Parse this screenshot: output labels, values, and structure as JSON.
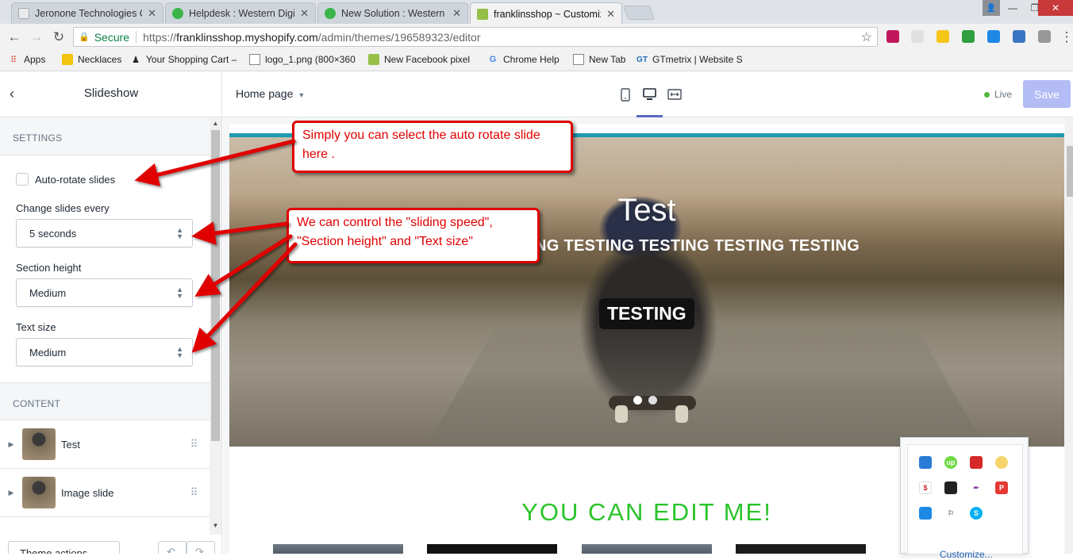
{
  "browser": {
    "tabs": [
      {
        "title": "Jeronone Technologies C",
        "favicon_color": "#e8eaed"
      },
      {
        "title": "Helpdesk : Western Digit",
        "favicon_color": "#3bb54a"
      },
      {
        "title": "New Solution : Western D",
        "favicon_color": "#3bb54a"
      },
      {
        "title": "franklinsshop ~ Customiz",
        "favicon_color": "#95bf47"
      }
    ],
    "secure_label": "Secure",
    "url_scheme": "https://",
    "url_host": "franklinsshop.myshopify.com",
    "url_path": "/admin/themes/196589323/editor",
    "bookmarks": [
      {
        "label": "Apps",
        "icon": "apps-grid-icon"
      },
      {
        "label": "Necklaces",
        "icon": "folder-icon"
      },
      {
        "label": "Your Shopping Cart –",
        "icon": "person-icon"
      },
      {
        "label": "logo_1.png (800×360",
        "icon": "page-icon"
      },
      {
        "label": "New Facebook pixel",
        "icon": "shopify-icon"
      },
      {
        "label": "Chrome Help",
        "icon": "google-icon"
      },
      {
        "label": "New Tab",
        "icon": "page-icon"
      },
      {
        "label": "GTmetrix | Website S",
        "icon": "gtmetrix-icon"
      }
    ],
    "user_initial": "👤"
  },
  "editor": {
    "sidebar_title": "Slideshow",
    "page_selector": "Home page",
    "live_label": "Live",
    "save_label": "Save"
  },
  "settings": {
    "section_label": "SETTINGS",
    "autorotate_label": "Auto-rotate slides",
    "autorotate_checked": false,
    "change_label": "Change slides every",
    "change_value": "5 seconds",
    "height_label": "Section height",
    "height_value": "Medium",
    "textsize_label": "Text size",
    "textsize_value": "Medium"
  },
  "content": {
    "section_label": "CONTENT",
    "blocks": [
      {
        "label": "Test"
      },
      {
        "label": "Image slide"
      }
    ],
    "footer_button": "Theme actions"
  },
  "preview": {
    "hero_title": "Test",
    "hero_subtitle": "NG TESTING TESTING TESTING TESTING",
    "hero_button": "TESTING",
    "active_slide": 1,
    "slide_count": 2,
    "edit_heading": "YOU CAN EDIT ME!"
  },
  "extension_popup": {
    "customize_label": "Customize..."
  },
  "annotations": {
    "callout1": "Simply you can select the auto rotate slide here .",
    "callout2_line1": "We can control the \"sliding speed\",",
    "callout2_line2": "\"Section height\" and \"Text size\""
  },
  "colors": {
    "accent": "#5c6ac4",
    "save_disabled": "#b3bcf5",
    "live_dot": "#50b83c",
    "annotation_red": "#e00000",
    "edit_heading": "#2bc42b"
  }
}
